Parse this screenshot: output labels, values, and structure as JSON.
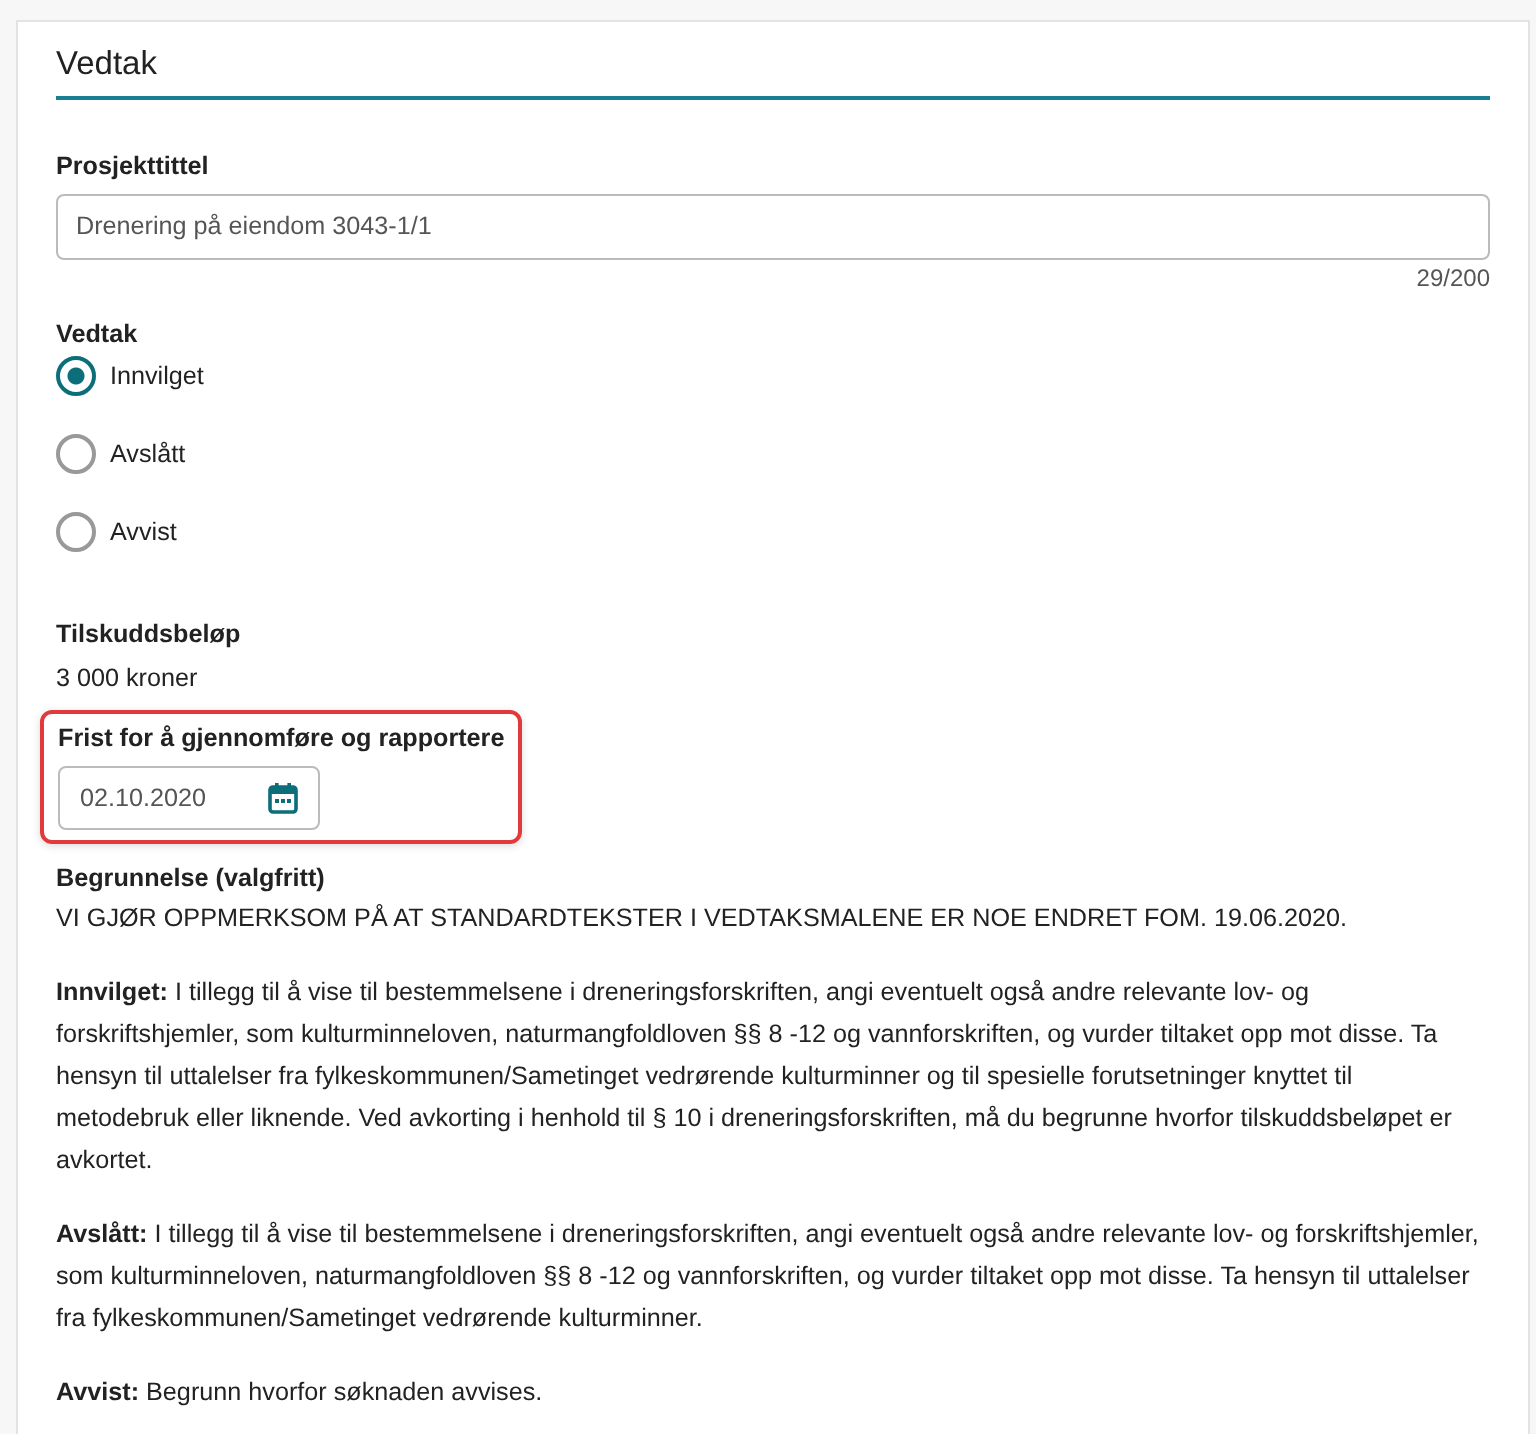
{
  "section": {
    "title": "Vedtak"
  },
  "project_title": {
    "label": "Prosjekttittel",
    "value": "Drenering på eiendom 3043-1/1",
    "counter": "29/200"
  },
  "decision": {
    "label": "Vedtak",
    "options": [
      {
        "label": "Innvilget",
        "selected": true
      },
      {
        "label": "Avslått",
        "selected": false
      },
      {
        "label": "Avvist",
        "selected": false
      }
    ]
  },
  "grant": {
    "label": "Tilskuddsbeløp",
    "value": "3 000 kroner"
  },
  "deadline": {
    "label": "Frist for å gjennomføre og rapportere",
    "value": "02.10.2020",
    "highlighted": true
  },
  "justification": {
    "label": "Begrunnelse (valgfritt)",
    "paragraphs": [
      "VI GJØR OPPMERKSOM PÅ AT STANDARDTEKSTER I VEDTAKSMALENE ER NOE ENDRET FOM. 19.06.2020.",
      "**Innvilget:** I tillegg til å vise til bestemmelsene i dreneringsforskriften, angi eventuelt også andre relevante lov- og forskriftshjemler, som kulturminneloven, naturmangfoldloven §§ 8 -12 og vannforskriften, og vurder tiltaket opp mot disse. Ta hensyn til uttalelser fra fylkeskommunen/Sametinget vedrørende kulturminner og til spesielle forutsetninger knyttet til metodebruk eller liknende. Ved avkorting i henhold til § 10 i dreneringsforskriften, må du begrunne hvorfor tilskuddsbeløpet er avkortet.",
      "**Avslått:** I tillegg til å vise til bestemmelsene i dreneringsforskriften, angi eventuelt også andre relevante lov- og forskriftshjemler, som kulturminneloven, naturmangfoldloven §§ 8 -12 og vannforskriften, og vurder tiltaket opp mot disse. Ta hensyn til uttalelser fra fylkeskommunen/Sametinget vedrørende kulturminner.",
      "**Avvist:** Begrunn hvorfor søknaden avvises."
    ]
  }
}
